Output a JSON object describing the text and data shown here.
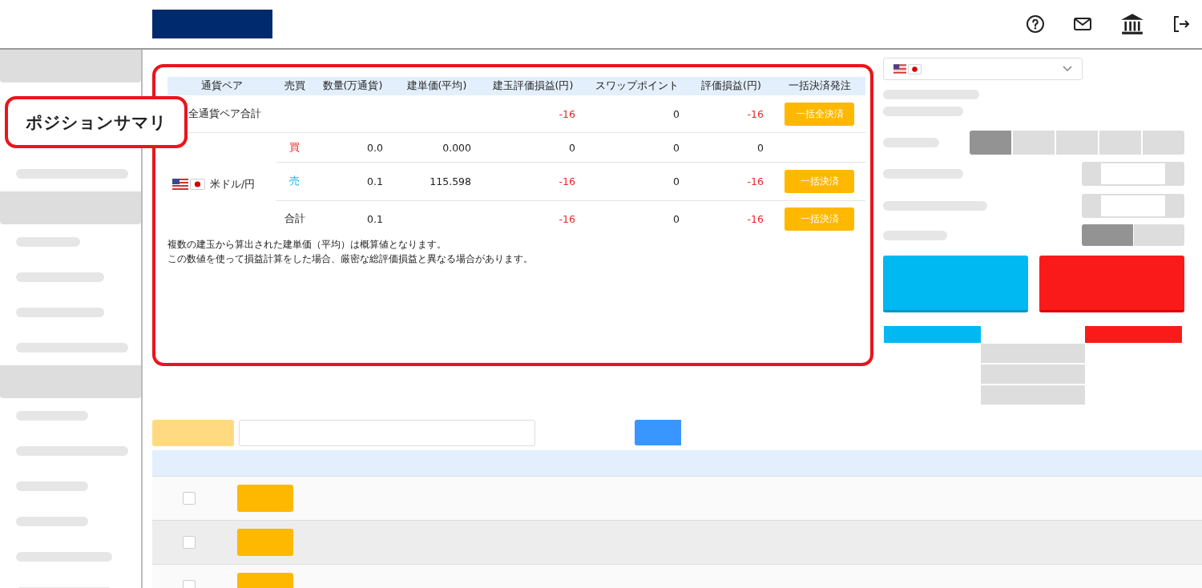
{
  "callout": {
    "label": "ポジションサマリ"
  },
  "summary": {
    "columns": [
      "通貨ペア",
      "売買",
      "数量(万通貨)",
      "建単価(平均)",
      "建玉評価損益(円)",
      "スワップポイント",
      "評価損益(円)",
      "一括決済発注"
    ],
    "total_row": {
      "label": "全通貨ペア合計",
      "pl": {
        "text": "-16",
        "loss": true
      },
      "swap": {
        "text": "0",
        "loss": false
      },
      "eval": {
        "text": "-16",
        "loss": true
      },
      "button": "一括全決済"
    },
    "pairs": [
      {
        "name": "米ドル/円",
        "rows": [
          {
            "side": "買",
            "kind": "buy",
            "qty": "0.0",
            "price": "0.000",
            "pl": {
              "text": "0",
              "loss": false
            },
            "swap": {
              "text": "0",
              "loss": false
            },
            "eval": {
              "text": "0",
              "loss": false
            }
          },
          {
            "side": "売",
            "kind": "sell",
            "qty": "0.1",
            "price": "115.598",
            "pl": {
              "text": "-16",
              "loss": true
            },
            "swap": {
              "text": "0",
              "loss": false
            },
            "eval": {
              "text": "-16",
              "loss": true
            },
            "button": "一括決済"
          },
          {
            "side": "合計",
            "kind": "total",
            "qty": "0.1",
            "pl": {
              "text": "-16",
              "loss": true
            },
            "swap": {
              "text": "0",
              "loss": false
            },
            "eval": {
              "text": "-16",
              "loss": true
            },
            "button": "一括決済"
          }
        ]
      }
    ],
    "notes": [
      "複数の建玉から算出された建単価（平均）は概算値となります。",
      "この数値を使って損益計算をした場合、厳密な総評価損益と異なる場合があります。"
    ]
  },
  "order_panel": {
    "lot_segments": [
      {
        "selected": true
      },
      {
        "selected": false
      },
      {
        "selected": false
      },
      {
        "selected": false
      },
      {
        "selected": false
      }
    ],
    "toggle": [
      {
        "selected": true
      },
      {
        "selected": false
      }
    ]
  },
  "positions": {
    "rows": [
      {
        "checked": false
      },
      {
        "checked": false
      },
      {
        "checked": false
      }
    ]
  }
}
